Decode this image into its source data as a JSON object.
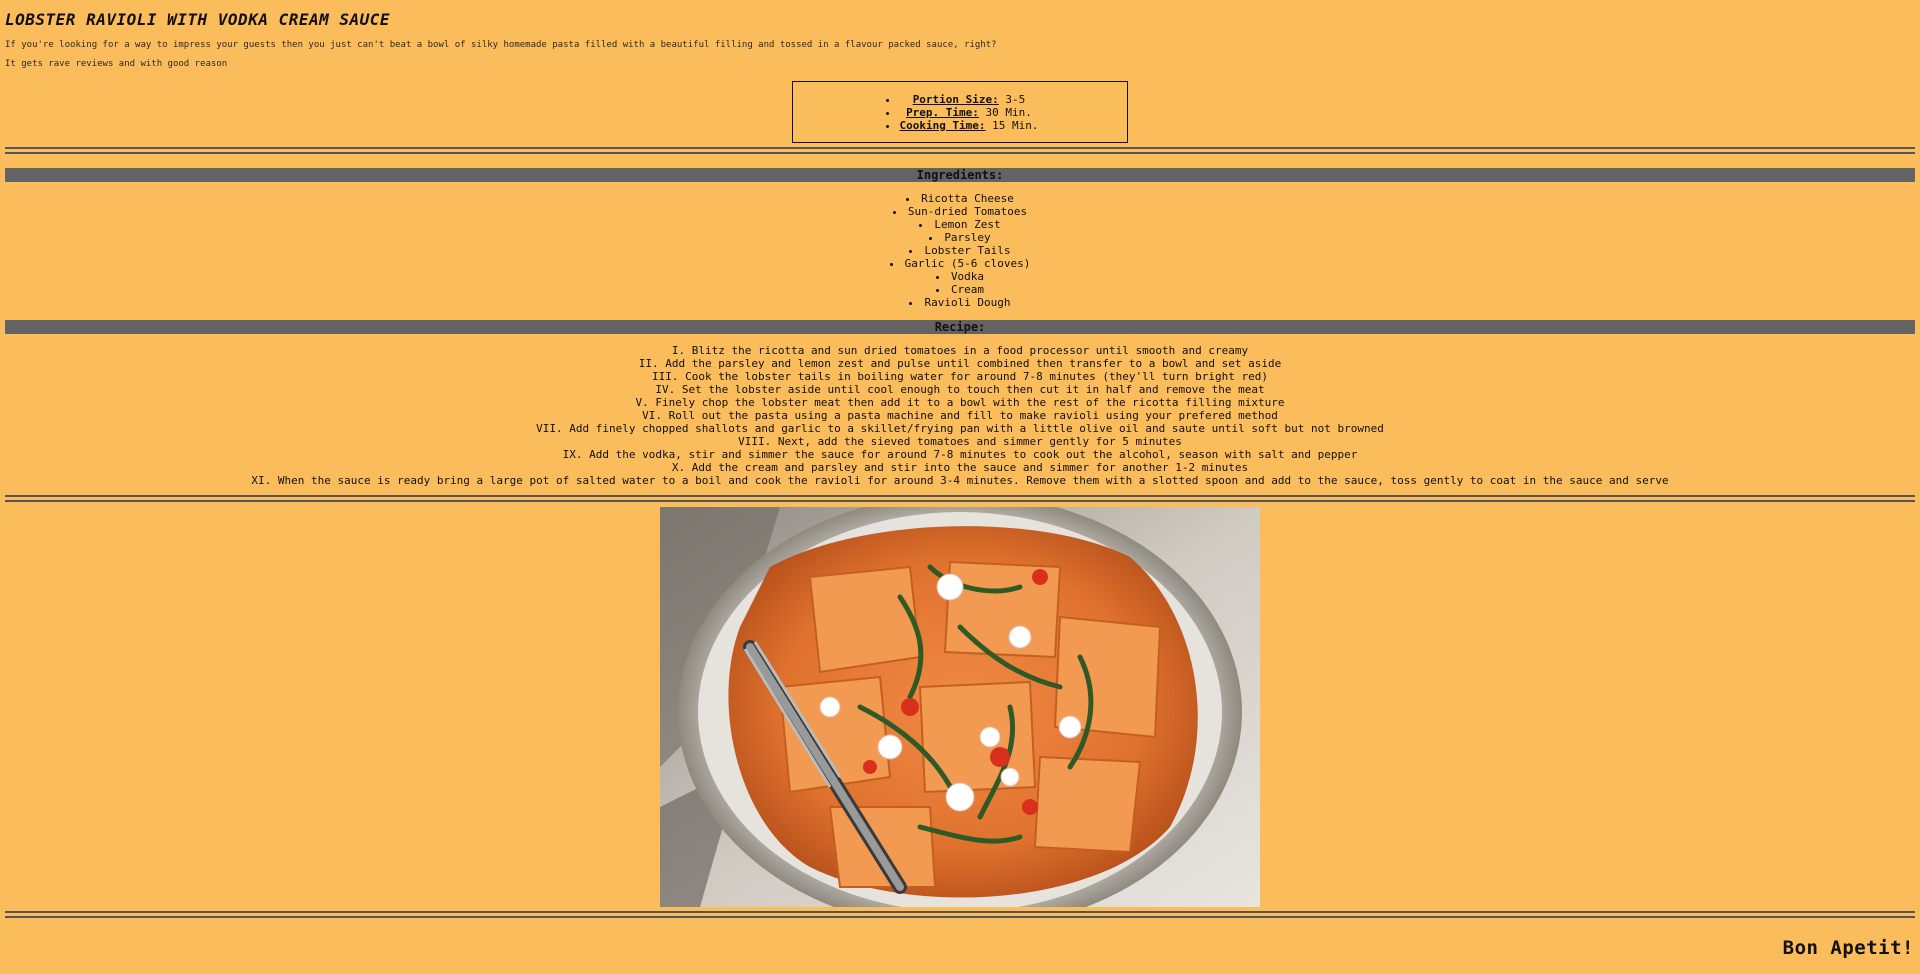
{
  "title": "LOBSTER RAVIOLI WITH VODKA CREAM SAUCE",
  "intro": [
    "If you're looking for a way to impress your guests then you just can't beat a bowl of silky homemade pasta filled with a beautiful filling and tossed in a flavour packed sauce, right?",
    "It gets rave reviews and with good reason"
  ],
  "info": [
    {
      "key": "Portion Size:",
      "value": " 3-5"
    },
    {
      "key": "Prep. Time:",
      "value": " 30 Min."
    },
    {
      "key": "Cooking Time:",
      "value": " 15 Min."
    }
  ],
  "ingredients_heading": "Ingredients:",
  "ingredients": [
    "Ricotta Cheese",
    "Sun-dried Tomatoes",
    "Lemon Zest",
    "Parsley",
    "Lobster Tails",
    "Garlic (5-6 cloves)",
    "Vodka",
    "Cream",
    "Ravioli Dough"
  ],
  "recipe_heading": "Recipe:",
  "recipe": [
    "Blitz the ricotta and sun dried tomatoes in a food processor until smooth and creamy",
    "Add the parsley and lemon zest and pulse until combined then transfer to a bowl and set aside",
    "Cook the lobster tails in boiling water for around 7-8 minutes (they'll turn bright red)",
    "Set the lobster aside until cool enough to touch then cut it in half and remove the meat",
    "Finely chop the lobster meat then add it to a bowl with the rest of the ricotta filling mixture",
    "Roll out the pasta using a pasta machine and fill to make ravioli using your prefered method",
    "Add finely chopped shallots and garlic to a skillet/frying pan with a little olive oil and saute until soft but not browned",
    "Next, add the sieved tomatoes and simmer gently for 5 minutes",
    "Add the vodka, stir and simmer the sauce for around 7-8 minutes to cook out the alcohol, season with salt and pepper",
    "Add the cream and parsley and stir into the sauce and simmer for another 1-2 minutes",
    "When the sauce is ready bring a large pot of salted water to a boil and cook the ravioli for around 3-4 minutes. Remove them with a slotted spoon and add to the sauce, toss gently to coat in the sauce and serve"
  ],
  "closing": "Bon Apetit!",
  "colors": {
    "background": "#fbbc5c",
    "section_bar": "#636363",
    "sauce": "#e07a3a"
  }
}
